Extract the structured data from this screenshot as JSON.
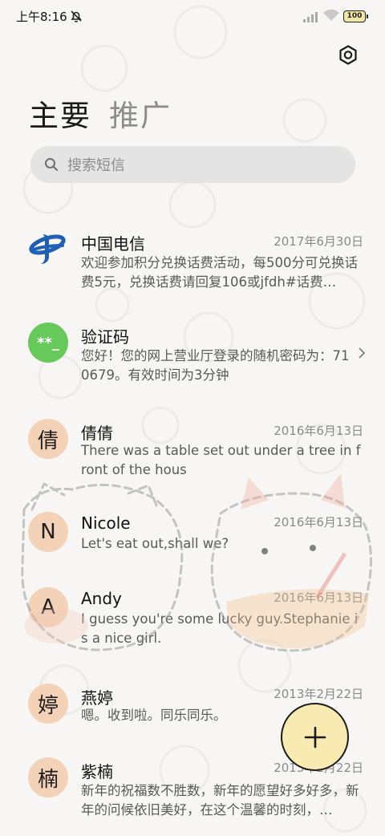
{
  "status_bar": {
    "time": "上午8:16",
    "battery": "100"
  },
  "tabs": [
    {
      "label": "主要",
      "active": true
    },
    {
      "label": "推广",
      "active": false
    }
  ],
  "search": {
    "placeholder": "搜索短信"
  },
  "conversations": [
    {
      "name": "中国电信",
      "date": "2017年6月30日",
      "snippet": "欢迎参加积分兑换话费活动，每500分可兑换话费5元，兑换话费请回复106或jfdh#话费…",
      "avatar": "logo",
      "avatar_text": ""
    },
    {
      "name": "验证码",
      "date": "",
      "snippet": "您好！您的网上营业厅登录的随机密码为：710679。有效时间为3分钟",
      "avatar": "green",
      "avatar_text": "**_"
    },
    {
      "name": "倩倩",
      "date": "2016年6月13日",
      "snippet": "There was a table set out under a tree in front of the hous",
      "avatar": "peach",
      "avatar_text": "倩"
    },
    {
      "name": "Nicole",
      "date": "2016年6月13日",
      "snippet": "Let's eat out,shall we?",
      "avatar": "peach",
      "avatar_text": "N"
    },
    {
      "name": "Andy",
      "date": "2016年6月13日",
      "snippet": "I guess you're some lucky guy.Stephanie is a nice girl.",
      "avatar": "peach",
      "avatar_text": "A"
    },
    {
      "name": "燕婷",
      "date": "2013年2月22日",
      "snippet": "嗯。收到啦。同乐同乐。",
      "avatar": "peach",
      "avatar_text": "婷"
    },
    {
      "name": "紫楠",
      "date": "2013年2月22日",
      "snippet": "新年的祝福数不胜数，新年的愿望好多好多，新年的问候依旧美好，在这个温馨的时刻，…",
      "avatar": "peach",
      "avatar_text": "楠"
    }
  ],
  "icons": {
    "settings": "settings-icon",
    "search": "search-icon",
    "compose": "plus-icon",
    "chevron": "chevron-right-icon"
  },
  "colors": {
    "avatar_peach": "#f3d2b8",
    "avatar_green": "#66c95a",
    "fab": "#f8eab0",
    "telecom_blue": "#1f5fb5"
  }
}
